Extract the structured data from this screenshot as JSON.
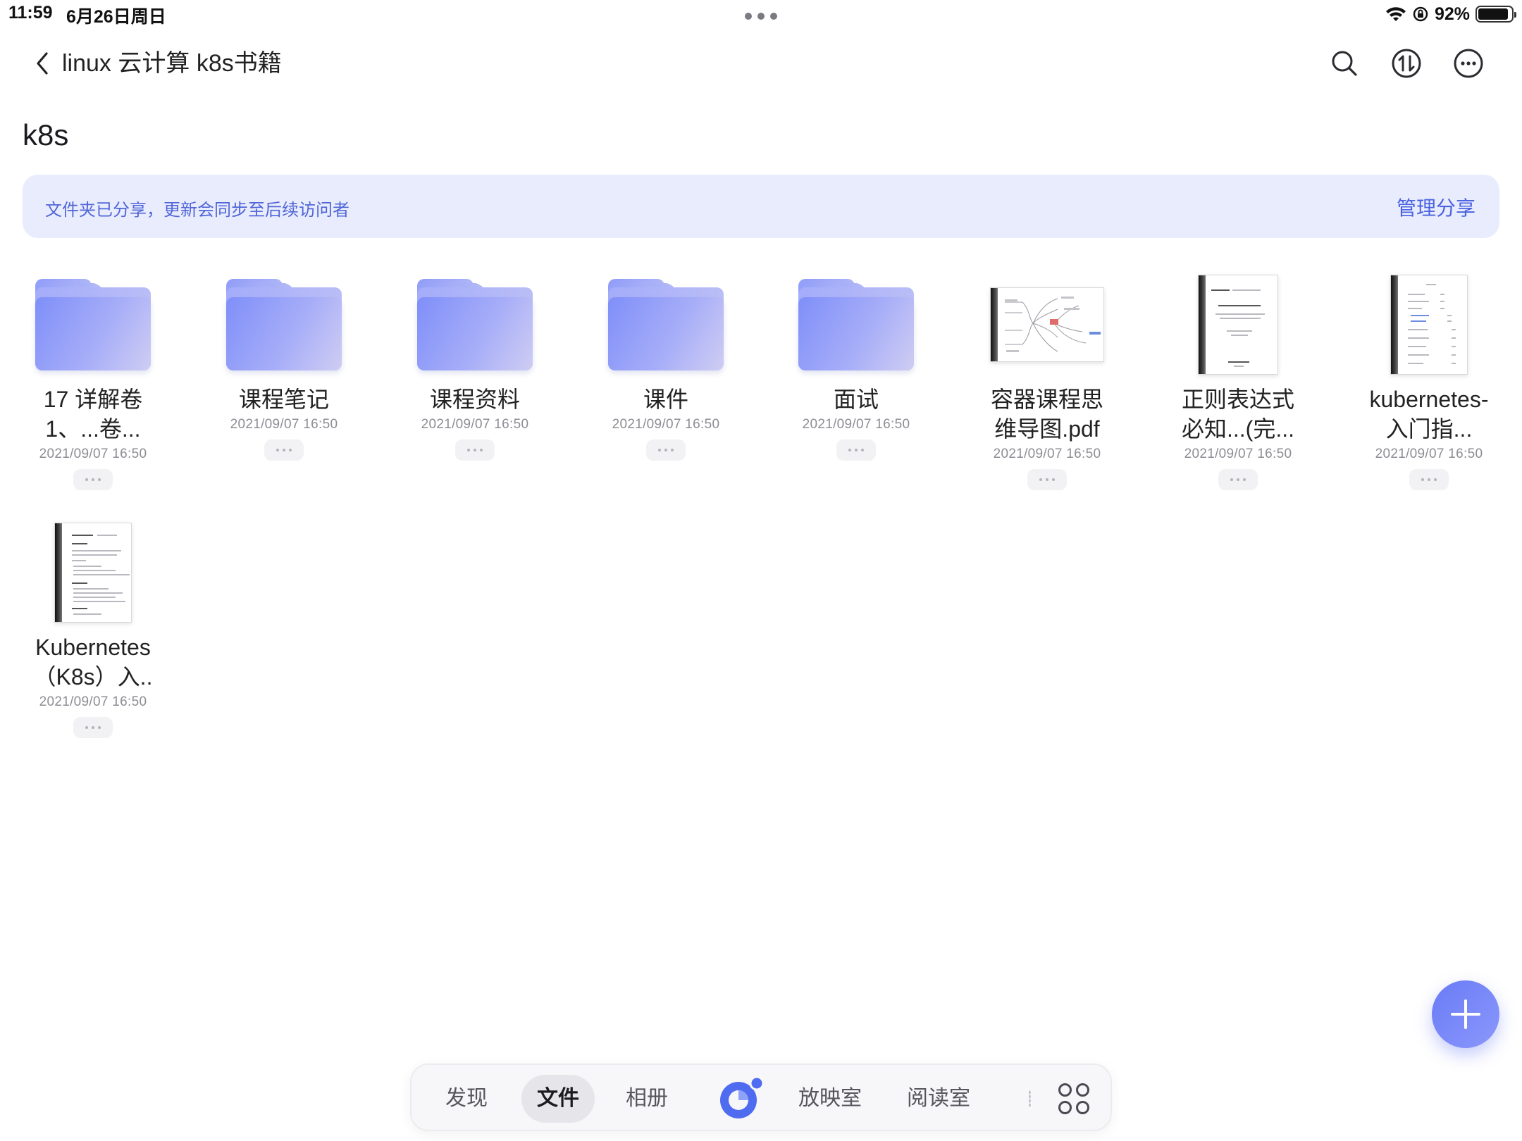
{
  "status": {
    "time": "11:59",
    "date": "6月26日周日",
    "battery": "92%",
    "battery_level": 0.92
  },
  "header": {
    "title": "linux 云计算 k8s书籍"
  },
  "folder": {
    "title": "k8s"
  },
  "banner": {
    "text": "文件夹已分享，更新会同步至后续访问者",
    "action": "管理分享"
  },
  "items": [
    {
      "kind": "folder",
      "name": "17 详解卷\n1、...卷...",
      "date": "2021/09/07 16:50"
    },
    {
      "kind": "folder",
      "name": "课程笔记",
      "date": "2021/09/07 16:50"
    },
    {
      "kind": "folder",
      "name": "课程资料",
      "date": "2021/09/07 16:50"
    },
    {
      "kind": "folder",
      "name": "课件",
      "date": "2021/09/07 16:50"
    },
    {
      "kind": "folder",
      "name": "面试",
      "date": "2021/09/07 16:50"
    },
    {
      "kind": "mindmap",
      "name": "容器课程思\n维导图.pdf",
      "date": "2021/09/07 16:50"
    },
    {
      "kind": "doc",
      "name": "正则表达式\n必知...(完...",
      "date": "2021/09/07 16:50"
    },
    {
      "kind": "doc",
      "name": "kubernetes-\n入门指...",
      "date": "2021/09/07 16:50"
    },
    {
      "kind": "doc",
      "name": "Kubernetes\n（K8s）入..",
      "date": "2021/09/07 16:50"
    }
  ],
  "dock": {
    "tabs": [
      "发现",
      "文件",
      "相册",
      "放映室",
      "阅读室"
    ],
    "active": "文件"
  },
  "colors": {
    "accent": "#4a62e0",
    "banner_bg": "#e9ecfd",
    "fab": "#6a7cf7"
  }
}
